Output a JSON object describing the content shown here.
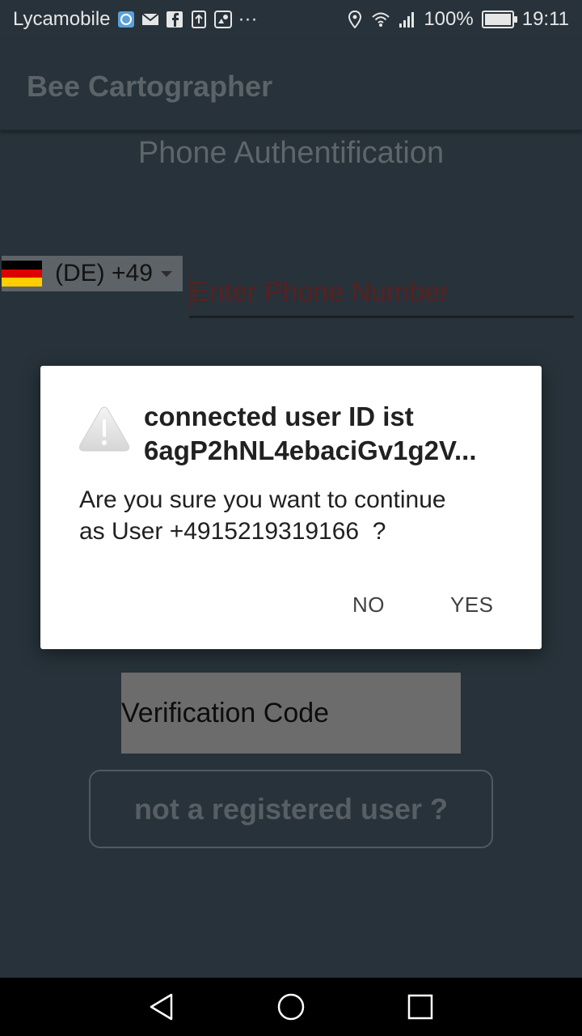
{
  "status_bar": {
    "carrier": "Lycamobile",
    "notification_icons": [
      "vpn-icon",
      "mail-icon",
      "facebook-icon",
      "upload-icon",
      "location-share-icon",
      "more-icon"
    ],
    "more": "···",
    "battery": "100%",
    "battery_level": 1.0,
    "time": "19:11"
  },
  "app_bar": {
    "title": "Bee Cartographer"
  },
  "screen_title": "Phone Authentification",
  "country_picker": {
    "code": "(DE) +49",
    "flag": "germany-flag"
  },
  "phone_input": {
    "placeholder": "Enter Phone Number"
  },
  "verification": {
    "label": "Verification Code"
  },
  "not_registered": {
    "label": "not a registered user ?"
  },
  "dialog": {
    "title_line1": "connected user ID ist",
    "title_line2": "6agP2hNL4ebaciGv1g2V...",
    "message_line1": "Are you sure you want to continue",
    "message_line2": "as User +4915219319166  ?",
    "no_label": "NO",
    "yes_label": "YES"
  },
  "colors": {
    "background": "#27323a",
    "dialog": "#ffffff",
    "placeholder": "#5a2020",
    "flag_black": "#000000",
    "flag_red": "#dd0000",
    "flag_gold": "#ffce00"
  }
}
